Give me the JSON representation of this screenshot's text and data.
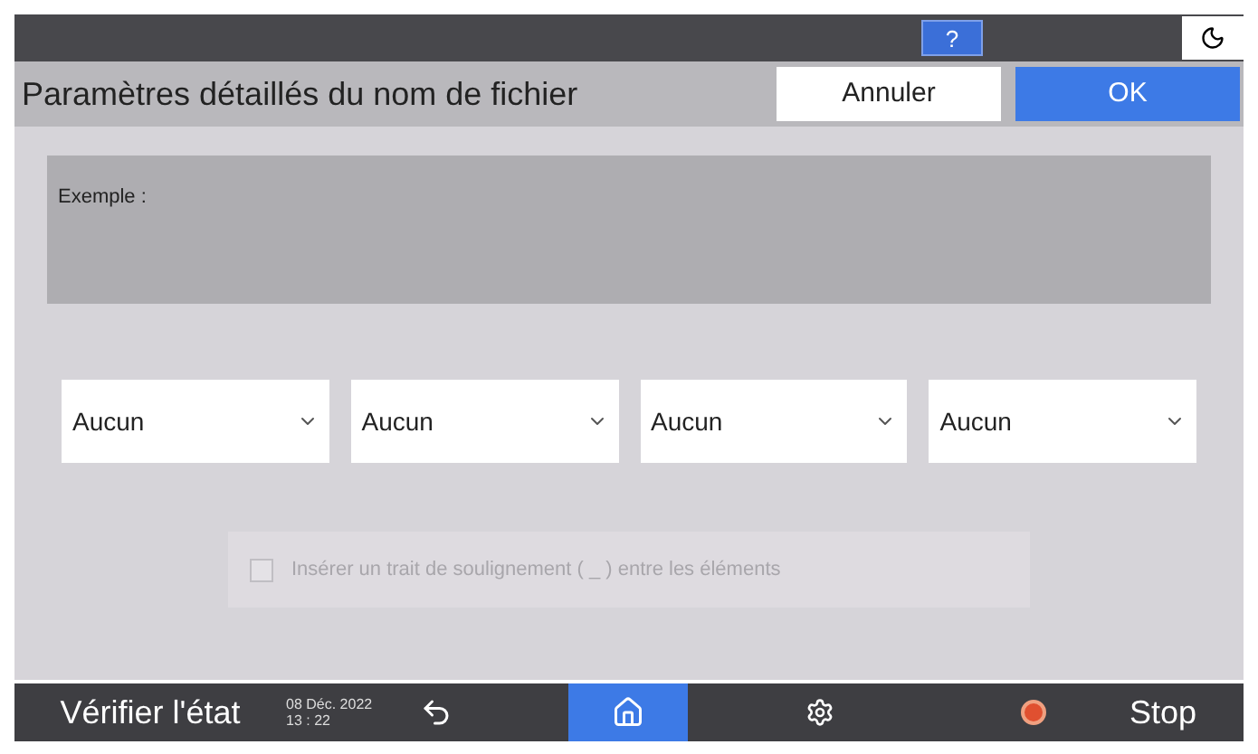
{
  "top_bar": {
    "help": "?"
  },
  "header": {
    "title": "Paramètres détaillés du nom de fichier",
    "cancel": "Annuler",
    "ok": "OK"
  },
  "example": {
    "label": "Exemple :"
  },
  "dropdowns": [
    {
      "value": "Aucun"
    },
    {
      "value": "Aucun"
    },
    {
      "value": "Aucun"
    },
    {
      "value": "Aucun"
    }
  ],
  "checkbox": {
    "label": "Insérer un trait de soulignement ( _ ) entre les éléments",
    "checked": false,
    "disabled": true
  },
  "bottom_bar": {
    "status": "Vérifier l'état",
    "date": "08 Déc. 2022",
    "time": "13 : 22",
    "stop": "Stop",
    "nav": [
      {
        "kind": "back",
        "selected": false
      },
      {
        "kind": "home",
        "selected": true
      },
      {
        "kind": "settings",
        "selected": false
      }
    ]
  }
}
